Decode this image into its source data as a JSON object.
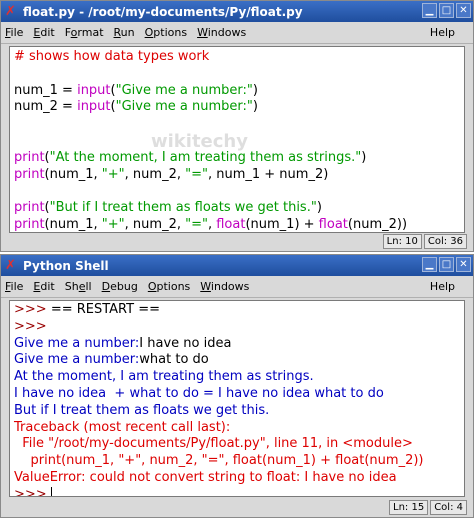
{
  "editor": {
    "title": "float.py - /root/my-documents/Py/float.py",
    "menu": [
      "File",
      "Edit",
      "Format",
      "Run",
      "Options",
      "Windows"
    ],
    "menu_underline": [
      "F",
      "E",
      "o",
      "R",
      "O",
      "W"
    ],
    "help": "Help",
    "lines": [
      [
        {
          "t": "# shows how data types work",
          "c": "cm"
        }
      ],
      [
        {
          "t": "",
          "c": ""
        }
      ],
      [
        {
          "t": "num_1 = ",
          "c": ""
        },
        {
          "t": "input",
          "c": "kw"
        },
        {
          "t": "(",
          "c": ""
        },
        {
          "t": "\"Give me a number:\"",
          "c": "str"
        },
        {
          "t": ")",
          "c": ""
        }
      ],
      [
        {
          "t": "num_2 = ",
          "c": ""
        },
        {
          "t": "input",
          "c": "kw"
        },
        {
          "t": "(",
          "c": ""
        },
        {
          "t": "\"Give me a number:\"",
          "c": "str"
        },
        {
          "t": ")",
          "c": ""
        }
      ],
      [
        {
          "t": "",
          "c": ""
        }
      ],
      [
        {
          "t": "",
          "c": ""
        }
      ],
      [
        {
          "t": "print",
          "c": "kw"
        },
        {
          "t": "(",
          "c": ""
        },
        {
          "t": "\"At the moment, I am treating them as strings.\"",
          "c": "str"
        },
        {
          "t": ")",
          "c": ""
        }
      ],
      [
        {
          "t": "print",
          "c": "kw"
        },
        {
          "t": "(num_1, ",
          "c": ""
        },
        {
          "t": "\"+\"",
          "c": "str"
        },
        {
          "t": ", num_2, ",
          "c": ""
        },
        {
          "t": "\"=\"",
          "c": "str"
        },
        {
          "t": ", num_1 + num_2)",
          "c": ""
        }
      ],
      [
        {
          "t": "",
          "c": ""
        }
      ],
      [
        {
          "t": "print",
          "c": "kw"
        },
        {
          "t": "(",
          "c": ""
        },
        {
          "t": "\"But if I treat them as floats we get this.\"",
          "c": "str"
        },
        {
          "t": ")",
          "c": ""
        }
      ],
      [
        {
          "t": "print",
          "c": "kw"
        },
        {
          "t": "(num_1, ",
          "c": ""
        },
        {
          "t": "\"+\"",
          "c": "str"
        },
        {
          "t": ", num_2, ",
          "c": ""
        },
        {
          "t": "\"=\"",
          "c": "str"
        },
        {
          "t": ", ",
          "c": ""
        },
        {
          "t": "float",
          "c": "kw"
        },
        {
          "t": "(num_1) + ",
          "c": ""
        },
        {
          "t": "float",
          "c": "kw"
        },
        {
          "t": "(num_2))",
          "c": ""
        }
      ]
    ],
    "status_line": "Ln: 10",
    "status_col": "Col: 36"
  },
  "shell": {
    "title": "Python Shell",
    "menu": [
      "File",
      "Edit",
      "Shell",
      "Debug",
      "Options",
      "Windows"
    ],
    "menu_underline": [
      "F",
      "E",
      "e",
      "D",
      "O",
      "W"
    ],
    "help": "Help",
    "lines": [
      [
        {
          "t": ">>> ",
          "c": "prompt"
        },
        {
          "t": "== RESTART ==",
          "c": "restart"
        }
      ],
      [
        {
          "t": ">>>",
          "c": "prompt"
        }
      ],
      [
        {
          "t": "Give me a number:",
          "c": "out"
        },
        {
          "t": "I have no idea",
          "c": ""
        }
      ],
      [
        {
          "t": "Give me a number:",
          "c": "out"
        },
        {
          "t": "what to do",
          "c": ""
        }
      ],
      [
        {
          "t": "At the moment, I am treating them as strings.",
          "c": "out"
        }
      ],
      [
        {
          "t": "I have no idea  + what to do = I have no idea what to do",
          "c": "out"
        }
      ],
      [
        {
          "t": "But if I treat them as floats we get this.",
          "c": "out"
        }
      ],
      [
        {
          "t": "Traceback (most recent call last):",
          "c": "err"
        }
      ],
      [
        {
          "t": "  File \"/root/my-documents/Py/float.py\", line 11, in <module>",
          "c": "err"
        }
      ],
      [
        {
          "t": "    print(num_1, \"+\", num_2, \"=\", float(num_1) + float(num_2))",
          "c": "err"
        }
      ],
      [
        {
          "t": "ValueError: could not convert string to float: I have no idea",
          "c": "err"
        }
      ]
    ],
    "final_prompt": ">>> ",
    "status_line": "Ln: 15",
    "status_col": "Col: 4"
  },
  "watermark": "wikitechy",
  "colors": {
    "titlebar": "#2a5cb0",
    "keyword": "#c000c0",
    "string": "#009900",
    "comment": "#dd0000",
    "output": "#0000c0",
    "error": "#dd0000"
  }
}
